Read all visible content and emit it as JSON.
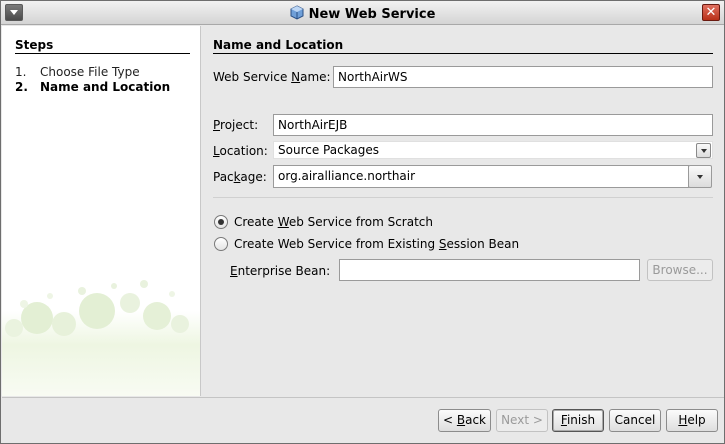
{
  "window": {
    "title": "New Web Service"
  },
  "steps": {
    "title": "Steps",
    "items": [
      {
        "num": "1.",
        "label": "Choose File Type"
      },
      {
        "num": "2.",
        "label": "Name and Location"
      }
    ]
  },
  "form": {
    "section_title": "Name and Location",
    "ws_name_label_pre": "Web Service ",
    "ws_name_label_mn": "N",
    "ws_name_label_post": "ame:",
    "ws_name_value": "NorthAirWS",
    "project_label_mn": "P",
    "project_label_post": "roject:",
    "project_value": "NorthAirEJB",
    "location_label_mn": "L",
    "location_label_post": "ocation:",
    "location_value": "Source Packages",
    "package_label_pre": "Pac",
    "package_label_mn": "k",
    "package_label_post": "age:",
    "package_value": "org.airalliance.northair",
    "radio1_pre": "Create ",
    "radio1_mn": "W",
    "radio1_post": "eb Service from Scratch",
    "radio1_checked": true,
    "radio2_pre": "Create Web Service from Existing ",
    "radio2_mn": "S",
    "radio2_post": "ession Bean",
    "radio2_checked": false,
    "bean_label_mn": "E",
    "bean_label_post": "nterprise Bean:",
    "bean_value": "",
    "browse_label": "Browse..."
  },
  "buttons": {
    "back_pre": "< ",
    "back_mn": "B",
    "back_post": "ack",
    "next": "Next >",
    "finish_mn": "F",
    "finish_post": "inish",
    "cancel": "Cancel",
    "help_mn": "H",
    "help_post": "elp"
  }
}
